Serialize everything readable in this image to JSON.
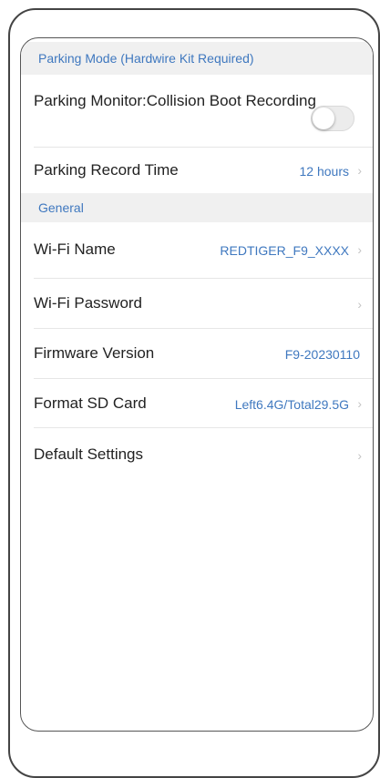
{
  "sections": {
    "parking": {
      "header": "Parking Mode (Hardwire Kit Required)",
      "collision_label": "Parking Monitor:Collision Boot Recording",
      "collision_enabled": false,
      "record_time_label": "Parking Record Time",
      "record_time_value": "12 hours"
    },
    "general": {
      "header": "General",
      "wifi_name_label": "Wi-Fi Name",
      "wifi_name_value": "REDTIGER_F9_XXXX",
      "wifi_password_label": "Wi-Fi Password",
      "firmware_label": "Firmware Version",
      "firmware_value": "F9-20230110",
      "format_label": "Format SD Card",
      "format_value": "Left6.4G/Total29.5G",
      "default_label": "Default Settings"
    }
  },
  "icons": {
    "chevron": "›"
  },
  "colors": {
    "accent": "#3f78bf",
    "section_bg": "#f0f0f0",
    "toggle_off": "#ececec"
  }
}
